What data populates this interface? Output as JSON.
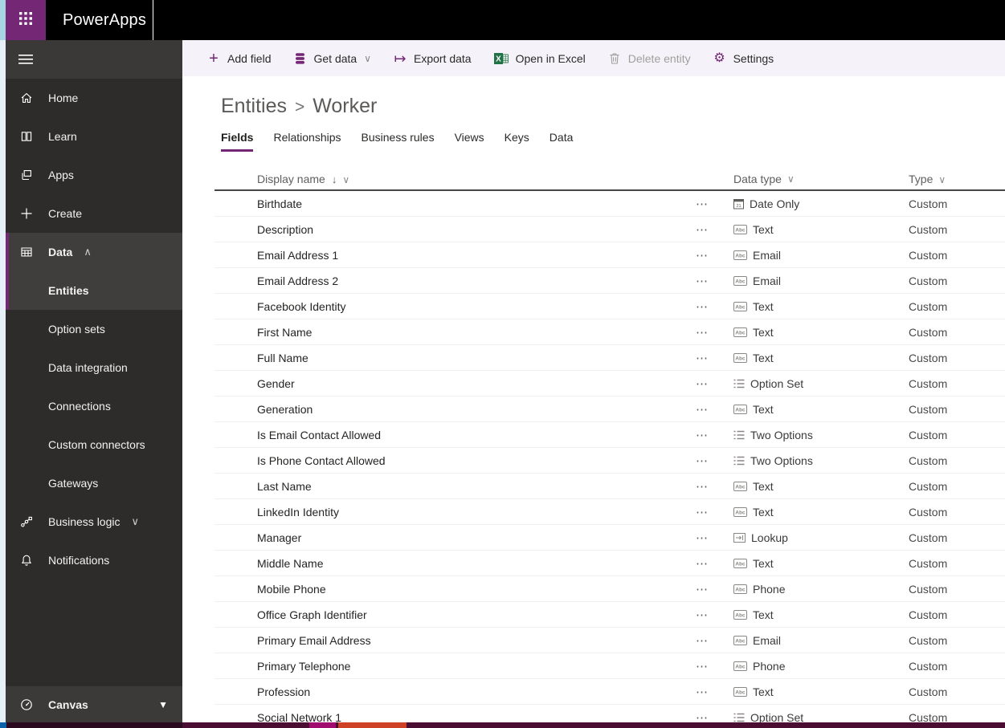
{
  "app": {
    "name": "PowerApps"
  },
  "sidebar": {
    "items": [
      {
        "label": "Home",
        "icon": "home-icon"
      },
      {
        "label": "Learn",
        "icon": "book-icon"
      },
      {
        "label": "Apps",
        "icon": "apps-icon"
      },
      {
        "label": "Create",
        "icon": "plus-icon"
      },
      {
        "label": "Data",
        "icon": "table-grid-icon",
        "chevron": "up",
        "expanded": true
      },
      {
        "label": "Entities",
        "selected": true
      },
      {
        "label": "Option sets"
      },
      {
        "label": "Data integration"
      },
      {
        "label": "Connections"
      },
      {
        "label": "Custom connectors"
      },
      {
        "label": "Gateways"
      },
      {
        "label": "Business logic",
        "icon": "flow-icon",
        "chevron": "down"
      },
      {
        "label": "Notifications",
        "icon": "bell-icon"
      }
    ],
    "footer": {
      "label": "Canvas",
      "icon": "gauge-icon"
    },
    "chevron_up": "∧",
    "chevron_down": "∨",
    "caret_down": "▼"
  },
  "toolbar": {
    "buttons": [
      {
        "label": "Add field",
        "icon": "add-icon"
      },
      {
        "label": "Get data",
        "icon": "database-icon",
        "dropdown": true
      },
      {
        "label": "Export data",
        "icon": "export-icon"
      },
      {
        "label": "Open in Excel",
        "icon": "excel-icon"
      },
      {
        "label": "Delete entity",
        "icon": "trash-icon",
        "disabled": true
      },
      {
        "label": "Settings",
        "icon": "gear-icon"
      }
    ],
    "dropdown_chevron": "∨"
  },
  "breadcrumb": {
    "parent": "Entities",
    "separator": ">",
    "current": "Worker"
  },
  "tabs": [
    {
      "label": "Fields",
      "active": true
    },
    {
      "label": "Relationships"
    },
    {
      "label": "Business rules"
    },
    {
      "label": "Views"
    },
    {
      "label": "Keys"
    },
    {
      "label": "Data"
    }
  ],
  "table": {
    "columns": [
      {
        "label": "Display name",
        "sorted": "descending",
        "sort_glyph": "↓",
        "chevron": "∨"
      },
      {
        "label": "Data type",
        "chevron": "∨"
      },
      {
        "label": "Type",
        "chevron": "∨"
      }
    ],
    "row_menu_glyph": "⋯",
    "rows": [
      {
        "name": "Birthdate",
        "data_type": "Date Only",
        "icon": "calendar-icon",
        "type": "Custom"
      },
      {
        "name": "Description",
        "data_type": "Text",
        "icon": "abc-icon",
        "type": "Custom"
      },
      {
        "name": "Email Address 1",
        "data_type": "Email",
        "icon": "abc-icon",
        "type": "Custom"
      },
      {
        "name": "Email Address 2",
        "data_type": "Email",
        "icon": "abc-icon",
        "type": "Custom"
      },
      {
        "name": "Facebook Identity",
        "data_type": "Text",
        "icon": "abc-icon",
        "type": "Custom"
      },
      {
        "name": "First Name",
        "data_type": "Text",
        "icon": "abc-icon",
        "type": "Custom"
      },
      {
        "name": "Full Name",
        "data_type": "Text",
        "icon": "abc-icon",
        "type": "Custom"
      },
      {
        "name": "Gender",
        "data_type": "Option Set",
        "icon": "list-icon",
        "type": "Custom"
      },
      {
        "name": "Generation",
        "data_type": "Text",
        "icon": "abc-icon",
        "type": "Custom"
      },
      {
        "name": "Is Email Contact Allowed",
        "data_type": "Two Options",
        "icon": "list-icon",
        "type": "Custom"
      },
      {
        "name": "Is Phone Contact Allowed",
        "data_type": "Two Options",
        "icon": "list-icon",
        "type": "Custom"
      },
      {
        "name": "Last Name",
        "data_type": "Text",
        "icon": "abc-icon",
        "type": "Custom"
      },
      {
        "name": "LinkedIn Identity",
        "data_type": "Text",
        "icon": "abc-icon",
        "type": "Custom"
      },
      {
        "name": "Manager",
        "data_type": "Lookup",
        "icon": "lookup-icon",
        "type": "Custom"
      },
      {
        "name": "Middle Name",
        "data_type": "Text",
        "icon": "abc-icon",
        "type": "Custom"
      },
      {
        "name": "Mobile Phone",
        "data_type": "Phone",
        "icon": "abc-icon",
        "type": "Custom"
      },
      {
        "name": "Office Graph Identifier",
        "data_type": "Text",
        "icon": "abc-icon",
        "type": "Custom"
      },
      {
        "name": "Primary Email Address",
        "data_type": "Email",
        "icon": "abc-icon",
        "type": "Custom"
      },
      {
        "name": "Primary Telephone",
        "data_type": "Phone",
        "icon": "abc-icon",
        "type": "Custom"
      },
      {
        "name": "Profession",
        "data_type": "Text",
        "icon": "abc-icon",
        "type": "Custom"
      },
      {
        "name": "Social Network 1",
        "data_type": "Option Set",
        "icon": "list-icon",
        "type": "Custom"
      }
    ]
  },
  "colors": {
    "brand_purple": "#742774",
    "topbar_black": "#000000",
    "toolbar_bg": "#f5f2f9",
    "excel_green": "#217346",
    "disabled_gray": "#a19f9d"
  }
}
